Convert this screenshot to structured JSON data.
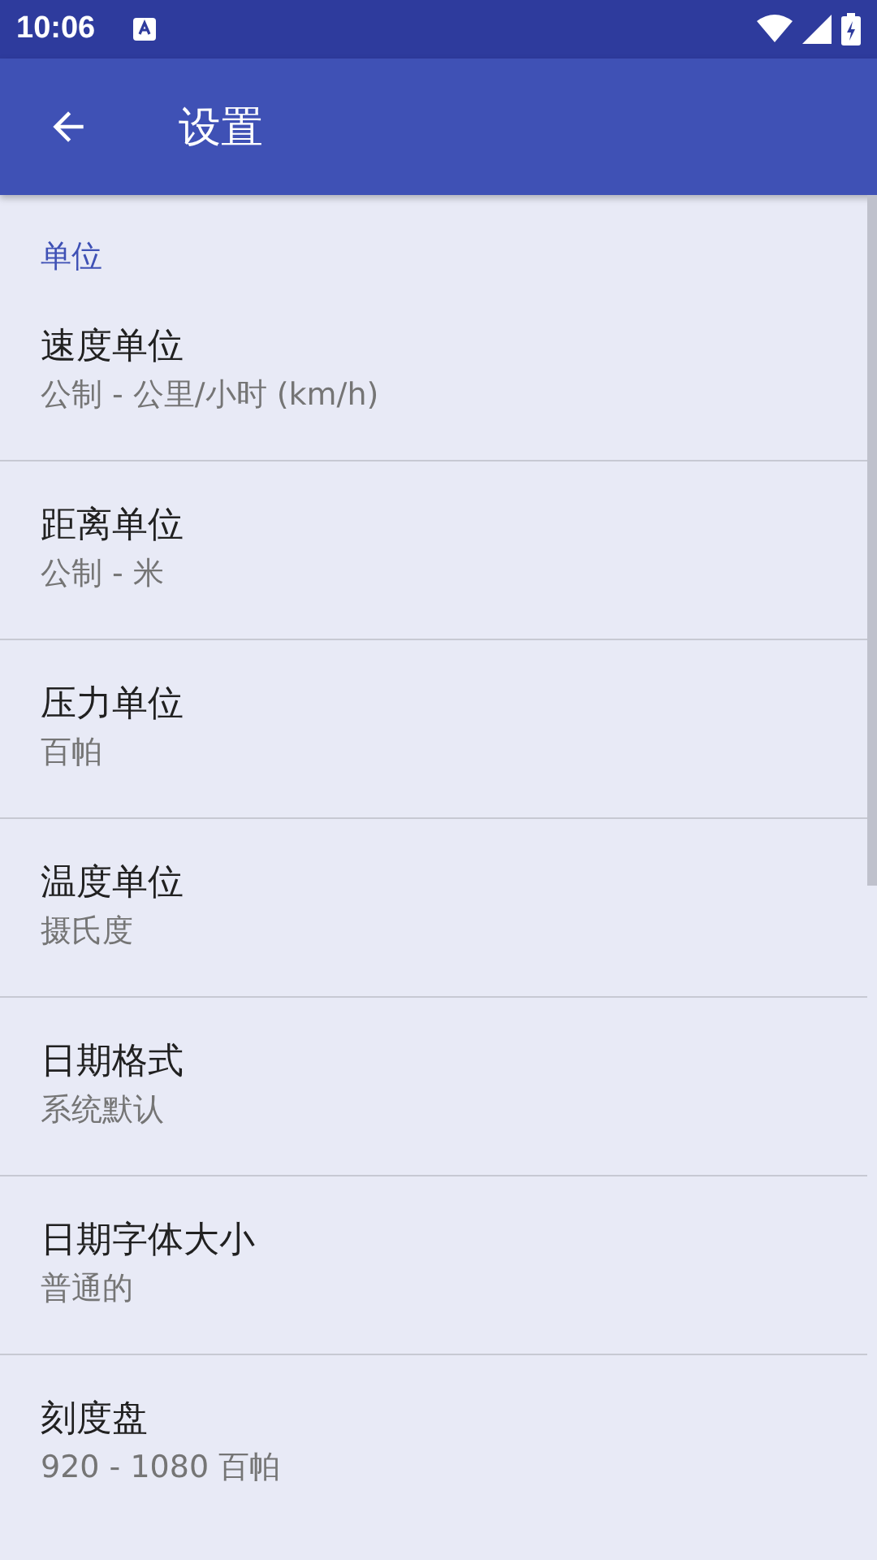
{
  "status_bar": {
    "time": "10:06"
  },
  "app_bar": {
    "title": "设置"
  },
  "section": {
    "title": "单位"
  },
  "items": [
    {
      "title": "速度单位",
      "summary": "公制 - 公里/小时 (km/h)"
    },
    {
      "title": "距离单位",
      "summary": "公制 - 米"
    },
    {
      "title": "压力单位",
      "summary": "百帕"
    },
    {
      "title": "温度单位",
      "summary": "摄氏度"
    },
    {
      "title": "日期格式",
      "summary": "系统默认"
    },
    {
      "title": "日期字体大小",
      "summary": "普通的"
    },
    {
      "title": "刻度盘",
      "summary": "920 - 1080 百帕"
    }
  ]
}
